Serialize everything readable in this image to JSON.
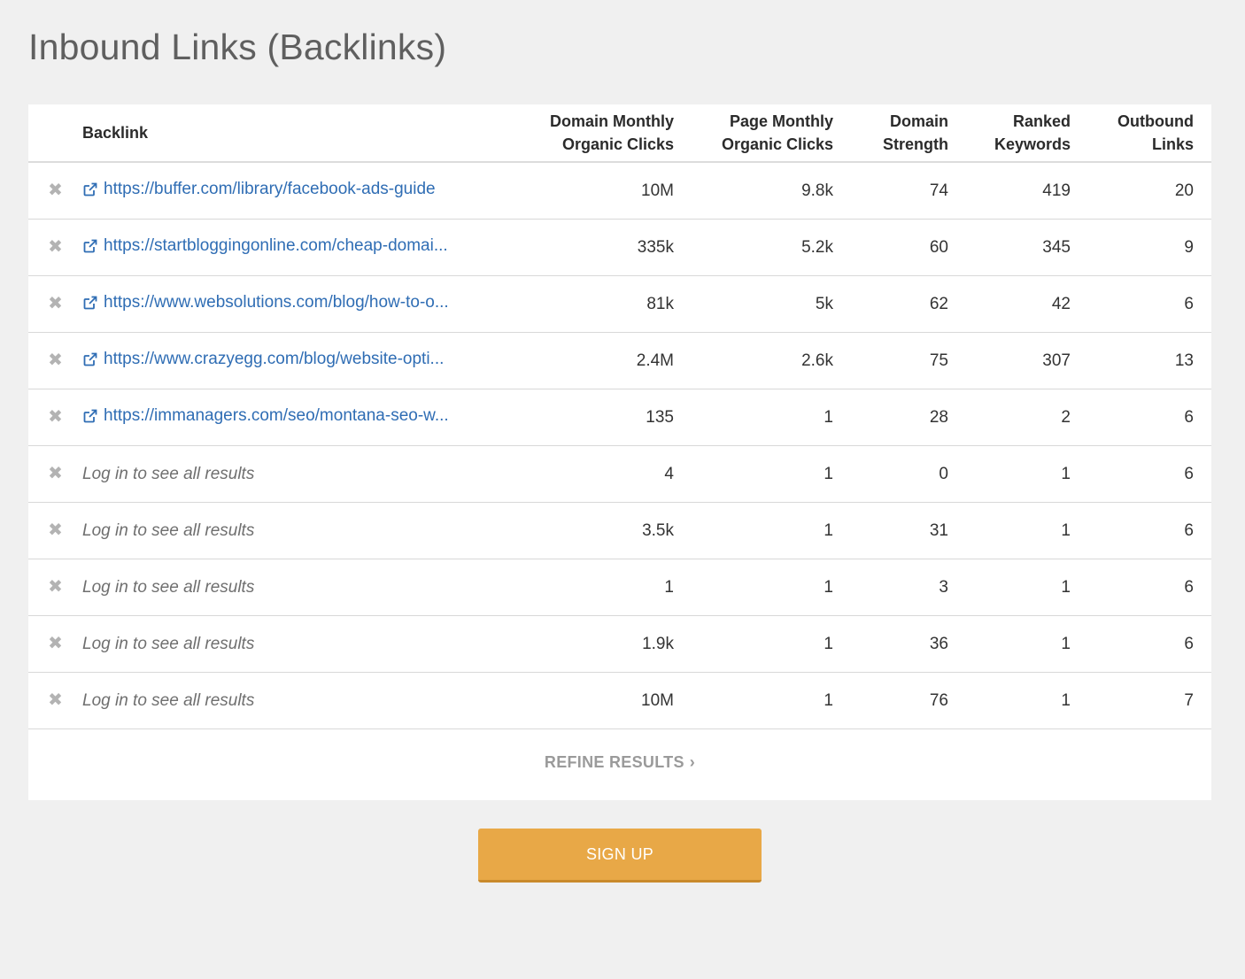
{
  "page": {
    "title": "Inbound Links (Backlinks)"
  },
  "table": {
    "headers": {
      "backlink": "Backlink",
      "domain_monthly_organic_clicks": [
        "Domain Monthly",
        "Organic Clicks"
      ],
      "page_monthly_organic_clicks": [
        "Page Monthly",
        "Organic Clicks"
      ],
      "domain_strength": [
        "Domain",
        "Strength"
      ],
      "ranked_keywords": [
        "Ranked",
        "Keywords"
      ],
      "outbound_links": [
        "Outbound",
        "Links"
      ]
    },
    "rows": [
      {
        "backlink": "https://buffer.com/library/facebook-ads-guide",
        "is_link": true,
        "dmoc": "10M",
        "pmoc": "9.8k",
        "ds": "74",
        "rk": "419",
        "ol": "20"
      },
      {
        "backlink": "https://startbloggingonline.com/cheap-domai...",
        "is_link": true,
        "dmoc": "335k",
        "pmoc": "5.2k",
        "ds": "60",
        "rk": "345",
        "ol": "9"
      },
      {
        "backlink": "https://www.websolutions.com/blog/how-to-o...",
        "is_link": true,
        "dmoc": "81k",
        "pmoc": "5k",
        "ds": "62",
        "rk": "42",
        "ol": "6"
      },
      {
        "backlink": "https://www.crazyegg.com/blog/website-opti...",
        "is_link": true,
        "dmoc": "2.4M",
        "pmoc": "2.6k",
        "ds": "75",
        "rk": "307",
        "ol": "13"
      },
      {
        "backlink": "https://immanagers.com/seo/montana-seo-w...",
        "is_link": true,
        "dmoc": "135",
        "pmoc": "1",
        "ds": "28",
        "rk": "2",
        "ol": "6"
      },
      {
        "backlink": "Log in to see all results",
        "is_link": false,
        "dmoc": "4",
        "pmoc": "1",
        "ds": "0",
        "rk": "1",
        "ol": "6"
      },
      {
        "backlink": "Log in to see all results",
        "is_link": false,
        "dmoc": "3.5k",
        "pmoc": "1",
        "ds": "31",
        "rk": "1",
        "ol": "6"
      },
      {
        "backlink": "Log in to see all results",
        "is_link": false,
        "dmoc": "1",
        "pmoc": "1",
        "ds": "3",
        "rk": "1",
        "ol": "6"
      },
      {
        "backlink": "Log in to see all results",
        "is_link": false,
        "dmoc": "1.9k",
        "pmoc": "1",
        "ds": "36",
        "rk": "1",
        "ol": "6"
      },
      {
        "backlink": "Log in to see all results",
        "is_link": false,
        "dmoc": "10M",
        "pmoc": "1",
        "ds": "76",
        "rk": "1",
        "ol": "7"
      }
    ],
    "remove_icon": "close-x-icon",
    "link_icon": "external-link-icon"
  },
  "refine": {
    "label": "REFINE RESULTS",
    "chevron": "›"
  },
  "signup": {
    "label": "SIGN UP"
  },
  "colors": {
    "background": "#f0f0f0",
    "link": "#2f6db4",
    "signup_button": "#e8a847"
  }
}
